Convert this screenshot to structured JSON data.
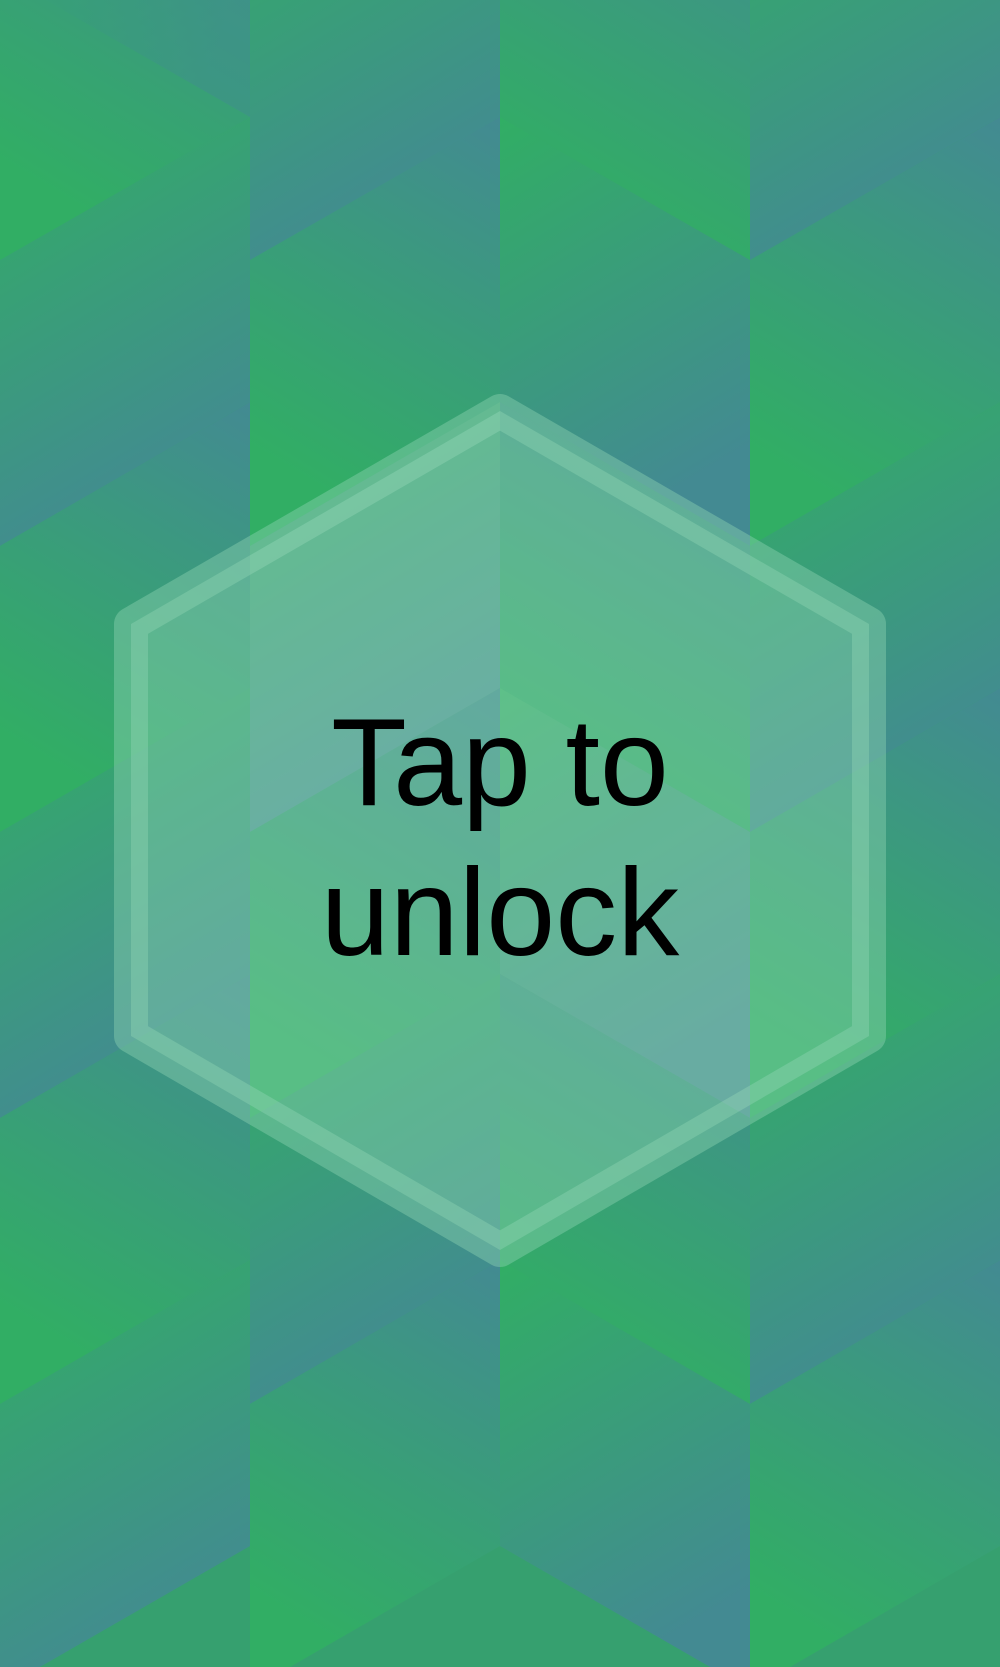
{
  "lock_screen": {
    "prompt_line1": "Tap to",
    "prompt_line2": "unlock"
  },
  "colors": {
    "green": "#31ae64",
    "teal": "#438a92",
    "panel_overlay": "#8fd3b2",
    "text": "#000000"
  }
}
